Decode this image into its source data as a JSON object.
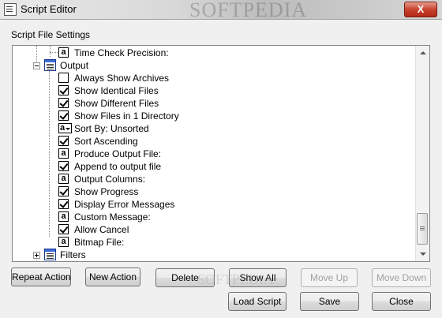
{
  "window": {
    "title": "Script Editor",
    "watermark": "SOFTPEDIA",
    "close_label": "X"
  },
  "group_label": "Script File Settings",
  "tree": {
    "items": [
      {
        "label": "Time Check Precision:",
        "icon": "text-icon"
      },
      {
        "label": "Output",
        "icon": "folder-icon",
        "expanded": true
      },
      {
        "label": "Always Show Archives",
        "icon": "checkbox",
        "checked": false
      },
      {
        "label": "Show Identical Files",
        "icon": "checkbox",
        "checked": true
      },
      {
        "label": "Show Different Files",
        "icon": "checkbox",
        "checked": true
      },
      {
        "label": "Show Files in 1 Directory",
        "icon": "checkbox",
        "checked": true
      },
      {
        "label": "Sort By: Unsorted",
        "icon": "dropdown-icon"
      },
      {
        "label": "Sort Ascending",
        "icon": "checkbox",
        "checked": true
      },
      {
        "label": "Produce Output File:",
        "icon": "text-icon"
      },
      {
        "label": "Append to output file",
        "icon": "checkbox",
        "checked": true
      },
      {
        "label": "Output Columns:",
        "icon": "text-icon"
      },
      {
        "label": "Show Progress",
        "icon": "checkbox",
        "checked": true
      },
      {
        "label": "Display Error Messages",
        "icon": "checkbox",
        "checked": true
      },
      {
        "label": "Custom Message:",
        "icon": "text-icon"
      },
      {
        "label": "Allow Cancel",
        "icon": "checkbox",
        "checked": true
      },
      {
        "label": "Bitmap File:",
        "icon": "text-icon"
      },
      {
        "label": "Filters",
        "icon": "folder-icon",
        "expanded": false
      }
    ]
  },
  "buttons": {
    "repeat_action": "Repeat Action",
    "new_action": "New Action",
    "delete": "Delete",
    "show_all": "Show All",
    "move_up": "Move Up",
    "move_down": "Move Down",
    "load_script": "Load Script",
    "save": "Save",
    "close": "Close"
  }
}
